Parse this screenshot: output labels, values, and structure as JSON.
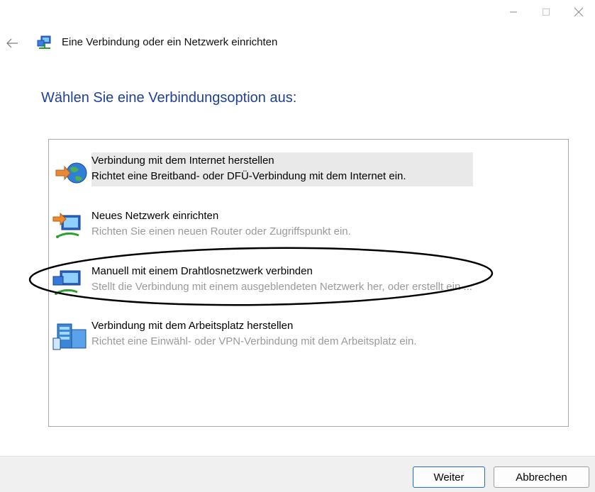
{
  "window": {
    "controls": [
      "—",
      "☐",
      "✕"
    ]
  },
  "header": {
    "title": "Eine Verbindung oder ein Netzwerk einrichten"
  },
  "main": {
    "heading": "Wählen Sie eine Verbindungsoption aus:"
  },
  "options": [
    {
      "title": "Verbindung mit dem Internet herstellen",
      "description": "Richtet eine Breitband- oder DFÜ-Verbindung mit dem Internet ein.",
      "icon": "globe-internet-icon",
      "selected": true
    },
    {
      "title": "Neues Netzwerk einrichten",
      "description": "Richten Sie einen neuen Router oder Zugriffspunkt ein.",
      "icon": "new-network-icon",
      "selected": false
    },
    {
      "title": "Manuell mit einem Drahtlosnetzwerk verbinden",
      "description": "Stellt die Verbindung mit einem ausgeblendeten Netzwerk her, oder erstellt ein ...",
      "icon": "wireless-network-icon",
      "selected": false
    },
    {
      "title": "Verbindung mit dem Arbeitsplatz herstellen",
      "description": "Richtet eine Einwähl- oder VPN-Verbindung mit dem Arbeitsplatz ein.",
      "icon": "workplace-vpn-icon",
      "selected": false
    }
  ],
  "footer": {
    "next_label": "Weiter",
    "cancel_label": "Abbrechen"
  },
  "colors": {
    "heading": "#1f3f9a",
    "selection": "#e9e9e9",
    "dim_text": "#9a9a9a"
  }
}
